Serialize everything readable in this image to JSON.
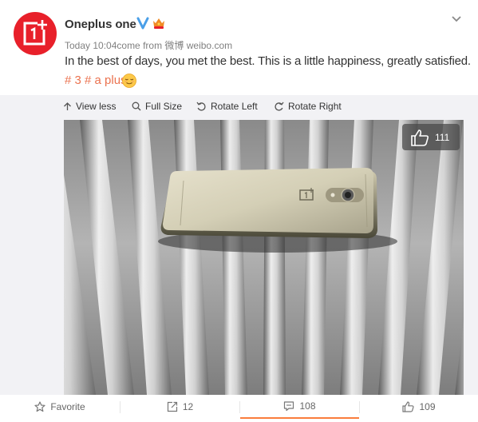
{
  "post": {
    "author": "Oneplus one",
    "time": "Today 10:04",
    "source_prefix": "come from",
    "source": "微博 weibo.com",
    "text": "In the best of days, you met the best. This is a little happiness, greatly satisfied.",
    "hashtag": "# 3 # a plus",
    "emoji": "relieved-face-emoji"
  },
  "toolbar": {
    "view_less": "View less",
    "full_size": "Full Size",
    "rotate_left": "Rotate Left",
    "rotate_right": "Rotate Right"
  },
  "image": {
    "like_count": "111",
    "phone_logo": "OnePlus logo"
  },
  "footer": {
    "favorite": "Favorite",
    "repost": "12",
    "comment": "108",
    "like": "109"
  },
  "colors": {
    "brand_red": "#e8202a",
    "verified_blue": "#4a9fe8",
    "hashtag": "#eb7350",
    "active_tab": "#fa7d3c"
  }
}
